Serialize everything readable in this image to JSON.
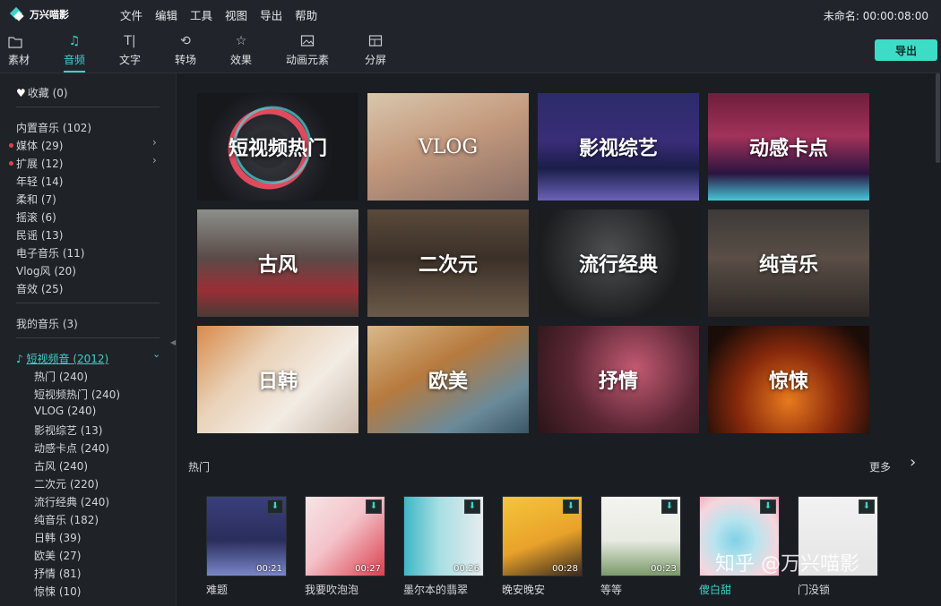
{
  "app": {
    "logo_text": "万兴喵影",
    "menu": [
      "文件",
      "编辑",
      "工具",
      "视图",
      "导出",
      "帮助"
    ],
    "title_info": "未命名: 00:00:08:00"
  },
  "toolbar": {
    "tabs": [
      {
        "label": "素材",
        "icon": "folder-icon"
      },
      {
        "label": "音频",
        "icon": "music-note-icon"
      },
      {
        "label": "文字",
        "icon": "text-icon"
      },
      {
        "label": "转场",
        "icon": "transition-icon"
      },
      {
        "label": "效果",
        "icon": "effects-icon"
      },
      {
        "label": "动画元素",
        "icon": "image-icon"
      },
      {
        "label": "分屏",
        "icon": "split-screen-icon"
      }
    ],
    "active_tab": "音频",
    "export_label": "导出"
  },
  "sidebar": {
    "favorites": "收藏 (0)",
    "builtin": [
      "内置音乐 (102)",
      "媒体 (29)",
      "扩展 (12)",
      "年轻 (14)",
      "柔和 (7)",
      "摇滚 (6)",
      "民谣 (13)",
      "电子音乐 (11)",
      "Vlog风 (20)",
      "音效 (25)"
    ],
    "my_music": "我的音乐 (3)",
    "short_video": "短视频音 (2012)",
    "sub_items": [
      "热门 (240)",
      "短视频热门 (240)",
      "VLOG (240)",
      "影视综艺 (13)",
      "动感卡点 (240)",
      "古风 (240)",
      "二次元 (220)",
      "流行经典 (240)",
      "纯音乐 (182)",
      "日韩 (39)",
      "欧美 (27)",
      "抒情 (81)",
      "惊悚 (10)"
    ]
  },
  "categories": [
    "短视频热门",
    "VLOG",
    "影视综艺",
    "动感卡点",
    "古风",
    "二次元",
    "流行经典",
    "纯音乐",
    "日韩",
    "欧美",
    "抒情",
    "惊悚"
  ],
  "hot": {
    "title": "热门",
    "more": "更多",
    "songs": [
      {
        "name": "难题",
        "duration": "00:21"
      },
      {
        "name": "我要吹泡泡",
        "duration": "00:27"
      },
      {
        "name": "墨尔本的翡翠",
        "duration": "00:26"
      },
      {
        "name": "晚安晚安",
        "duration": "00:28"
      },
      {
        "name": "等等",
        "duration": "00:23"
      },
      {
        "name": "傻白甜",
        "duration": ""
      },
      {
        "name": "门没锁",
        "duration": ""
      }
    ]
  },
  "watermark": "知乎 @万兴喵影",
  "colors": {
    "accent": "#3fd0c9",
    "export_button": "#3ddcc6",
    "alert_dot": "#e0404d"
  }
}
